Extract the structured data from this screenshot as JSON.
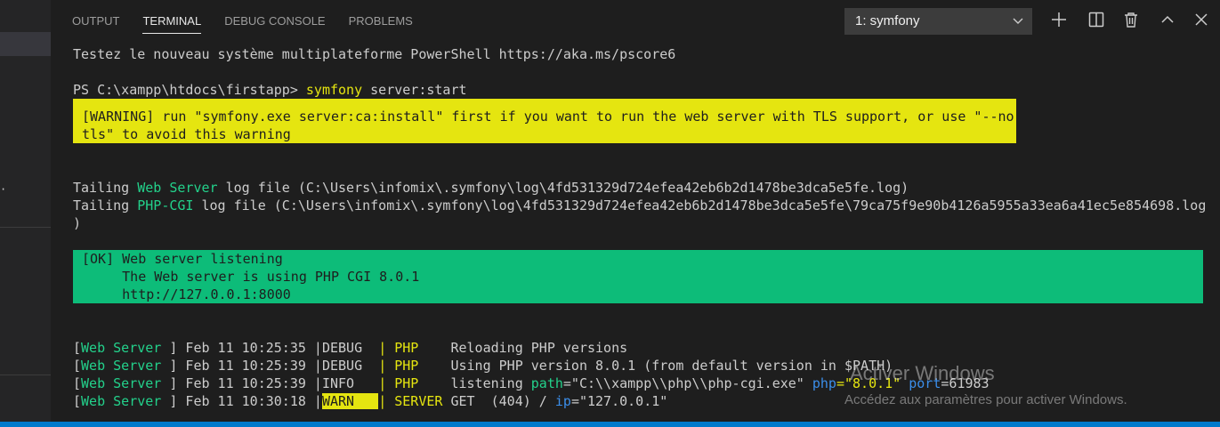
{
  "panel": {
    "tabs": [
      {
        "label": "OUTPUT"
      },
      {
        "label": "TERMINAL"
      },
      {
        "label": "DEBUG CONSOLE"
      },
      {
        "label": "PROBLEMS"
      }
    ],
    "active_tab": "TERMINAL",
    "terminal_select": "1: symfony",
    "toolbar_icons": [
      "plus-icon",
      "split-icon",
      "trash-icon",
      "chevron-up-icon",
      "close-icon"
    ]
  },
  "terminal": {
    "intro": "Testez le nouveau système multiplateforme PowerShell https://aka.ms/pscore6",
    "prompt": "PS C:\\xampp\\htdocs\\firstapp> ",
    "cmd_name": "symfony",
    "cmd_args": " server:start",
    "warning_line1": "[WARNING] run \"symfony.exe server:ca:install\" first if you want to run the web server with TLS support, or use \"--no-",
    "warning_line2": "tls\" to avoid this warning",
    "tail1": {
      "prefix": "Tailing ",
      "name": "Web Server",
      "rest": " log file (C:\\Users\\infomix\\.symfony\\log\\4fd531329d724efea42eb6b2d1478be3dca5e5fe.log)"
    },
    "tail2": {
      "prefix": "Tailing ",
      "name": "PHP-CGI",
      "rest": " log file (C:\\Users\\infomix\\.symfony\\log\\4fd531329d724efea42eb6b2d1478be3dca5e5fe\\79ca75f9e90b4126a5955a33ea6a41ec5e854698.log"
    },
    "tail2_cont": ")",
    "ok_line1": "[OK] Web server listening",
    "ok_line2": "     The Web server is using PHP CGI 8.0.1",
    "ok_line3": "     http://127.0.0.1:8000",
    "logs": [
      {
        "source": "Web Server",
        "time": " ] Feb 11 10:25:35 |",
        "level": "DEBUG",
        "pad": "  ",
        "sep": "| ",
        "channel": "PHP",
        "chpad": "    ",
        "message": "Reloading PHP versions",
        "k1": "",
        "v1": "",
        "k2": "",
        "v2": "",
        "k3": "",
        "v3": ""
      },
      {
        "source": "Web Server",
        "time": " ] Feb 11 10:25:39 |",
        "level": "DEBUG",
        "pad": "  ",
        "sep": "| ",
        "channel": "PHP",
        "chpad": "    ",
        "message": "Using PHP version 8.0.1 (from default version in $PATH)",
        "k1": "",
        "v1": "",
        "k2": "",
        "v2": "",
        "k3": "",
        "v3": ""
      },
      {
        "source": "Web Server",
        "time": " ] Feb 11 10:25:39 |",
        "level": "INFO",
        "pad": "   ",
        "sep": "| ",
        "channel": "PHP",
        "chpad": "    ",
        "message": "listening ",
        "k1": "path",
        "v1": "=\"C:\\\\xampp\\\\php\\\\php-cgi.exe\" ",
        "k2": "php",
        "v2": "=\"8.0.1\" ",
        "k3": "port",
        "v3": "=61983"
      },
      {
        "source": "Web Server",
        "time": " ] Feb 11 10:30:18 |",
        "level": "WARN",
        "pad": "   ",
        "sep": "| ",
        "channel": "SERVER",
        "chpad": " ",
        "message": "GET  (404) / ",
        "k1": "ip",
        "v1": "=\"127.0.0.1\"",
        "k2": "",
        "v2": "",
        "k3": "",
        "v3": ""
      }
    ]
  },
  "watermark": {
    "title": "Activer Windows",
    "subtitle": "Accédez aux paramètres pour activer Windows."
  }
}
